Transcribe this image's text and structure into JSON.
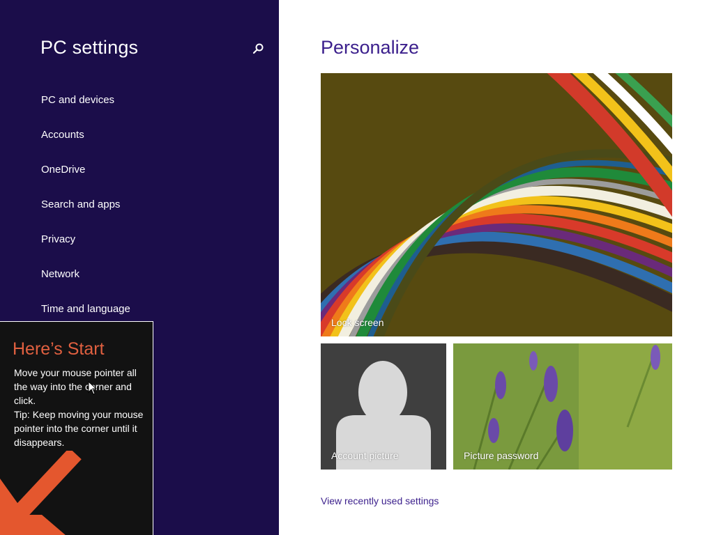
{
  "nav": {
    "title": "PC settings",
    "search_icon": "search-icon",
    "items": [
      {
        "label": "PC and devices"
      },
      {
        "label": "Accounts"
      },
      {
        "label": "OneDrive"
      },
      {
        "label": "Search and apps"
      },
      {
        "label": "Privacy"
      },
      {
        "label": "Network"
      },
      {
        "label": "Time and language"
      }
    ]
  },
  "content": {
    "title": "Personalize",
    "tiles": {
      "lock_screen": "Lock screen",
      "account_picture": "Account picture",
      "picture_password": "Picture password"
    },
    "recent_link": "View recently used settings"
  },
  "tip": {
    "title": "Here’s Start",
    "body": "Move your mouse pointer all the way into the corner and click.\nTip: Keep moving your mouse pointer into the corner until it disappears."
  },
  "colors": {
    "nav_background": "#1b0d4a",
    "accent": "#3b1f8c",
    "tip_title": "#e06040",
    "tip_arrow": "#e4572e"
  }
}
